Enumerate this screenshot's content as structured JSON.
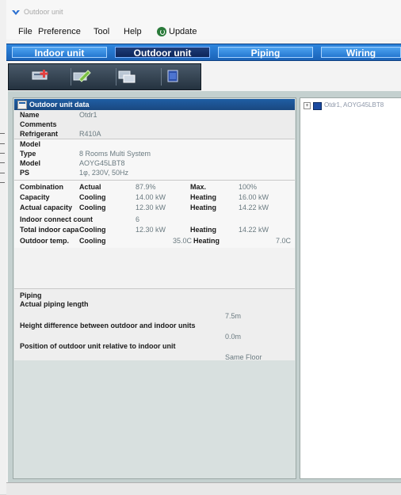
{
  "window": {
    "title": "Outdoor unit"
  },
  "menu": [
    {
      "label": "File"
    },
    {
      "label": "Preference"
    },
    {
      "label": "Tool"
    },
    {
      "label": "Help"
    },
    {
      "label": "Update",
      "icon": "update-icon"
    }
  ],
  "tabs": [
    {
      "label": "Indoor unit",
      "active": false
    },
    {
      "label": "Outdoor unit",
      "active": true
    },
    {
      "label": "Piping",
      "active": false
    },
    {
      "label": "Wiring",
      "active": false
    }
  ],
  "toolbar": {
    "buttons": [
      "add-unit-icon",
      "edit-icon",
      "copy-icon",
      "delete-icon"
    ]
  },
  "panel": {
    "header": "Outdoor unit data",
    "general": {
      "name_label": "Name",
      "name_value": "Otdr1",
      "comments_label": "Comments",
      "refrigerant_label": "Refrigerant",
      "refrigerant_value": "R410A"
    },
    "model": {
      "section_label": "Model",
      "type_label": "Type",
      "type_value": "8 Rooms Multi System",
      "model_label": "Model",
      "model_value": "AOYG45LBT8",
      "ps_label": "PS",
      "ps_value": "1φ, 230V, 50Hz"
    },
    "performance": {
      "combination_label": "Combination",
      "combination_sub": "Actual",
      "combination_actual": "87.9%",
      "combination_max_label": "Max.",
      "combination_max": "100%",
      "capacity_label": "Capacity",
      "capacity_sub": "Cooling",
      "capacity_cooling": "14.00 kW",
      "capacity_heat_label": "Heating",
      "capacity_heating": "16.00 kW",
      "actual_capacity_label": "Actual capacity",
      "actual_capacity_sub": "Cooling",
      "actual_capacity_cooling": "12.30 kW",
      "actual_capacity_heat_label": "Heating",
      "actual_capacity_heating": "14.22 kW",
      "indoor_count_label": "Indoor connect count",
      "indoor_count_value": "6",
      "total_indoor_label": "Total indoor capa",
      "total_indoor_sub": "Cooling",
      "total_indoor_cooling": "12.30 kW",
      "total_indoor_heat_label": "Heating",
      "total_indoor_heating": "14.22 kW",
      "outdoor_temp_label": "Outdoor temp.",
      "outdoor_temp_sub": "Cooling",
      "outdoor_temp_cooling": "35.0C",
      "outdoor_temp_heat_label": "Heating",
      "outdoor_temp_heating": "7.0C"
    },
    "piping": {
      "section_label": "Piping",
      "length_label": "Actual piping length",
      "length_value": "7.5m",
      "height_label": "Height difference between outdoor and indoor units",
      "height_value": "0.0m",
      "position_label": "Position of outdoor unit relative to indoor unit",
      "position_value": "Same Floor"
    }
  },
  "tree": {
    "node_label": "Otdr1, AOYG45LBT8"
  }
}
